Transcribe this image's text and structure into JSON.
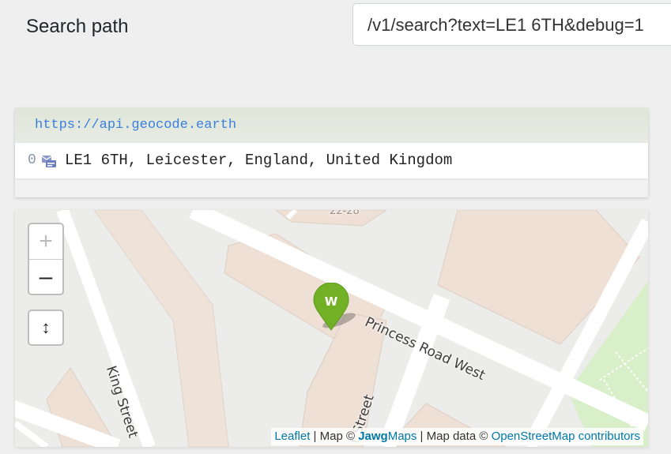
{
  "search": {
    "label": "Search path",
    "value": "/v1/search?text=LE1 6TH&debug=1"
  },
  "results": {
    "host": "https://api.geocode.earth",
    "items": [
      {
        "index": "0",
        "label": "LE1 6TH, Leicester, England, United Kingdom"
      }
    ]
  },
  "map": {
    "streets": {
      "princess_road_west": "Princess Road West",
      "king_street": "King Street",
      "partial_street": "t Street",
      "building_number": "22-28"
    },
    "controls": {
      "zoom_in": "+",
      "zoom_out": "–",
      "locate": "↕"
    },
    "marker_glyph": "W",
    "attribution": {
      "leaflet": "Leaflet",
      "sep1": " | Map © ",
      "jawg": "Jawg",
      "maps": "Maps",
      "sep2": " | Map data © ",
      "osm": "OpenStreetMap contributors"
    },
    "colors": {
      "marker": "#72b026",
      "road": "#ffffff",
      "building": "#efe0d6",
      "park": "#d9efc9"
    }
  }
}
